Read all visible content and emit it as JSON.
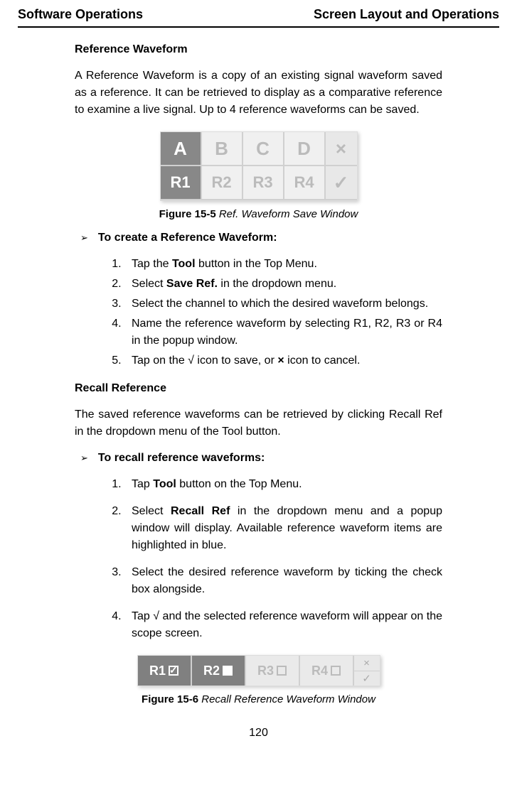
{
  "header": {
    "left": "Software Operations",
    "right": "Screen Layout and Operations"
  },
  "section1": {
    "title": "Reference Waveform",
    "para": "A Reference Waveform is a copy of an existing signal waveform saved as a reference. It can be retrieved to display as a comparative reference to examine a live signal. Up to 4 reference waveforms can be saved."
  },
  "fig5": {
    "row_top": [
      "A",
      "B",
      "C",
      "D",
      "×"
    ],
    "row_bot": [
      "R1",
      "R2",
      "R3",
      "R4",
      "✓"
    ],
    "caption_bold": "Figure 15-5",
    "caption_italic": " Ref. Waveform Save Window"
  },
  "proc1": {
    "title": "To create a Reference Waveform",
    "steps": {
      "s1a": "Tap the ",
      "s1b": "Tool",
      "s1c": " button in the Top Menu.",
      "s2a": "Select ",
      "s2b": "Save Ref.",
      "s2c": " in the dropdown menu.",
      "s3": "Select the channel to which the desired waveform belongs.",
      "s4": "Name the reference waveform by selecting R1, R2, R3 or R4 in the popup window.",
      "s5a": "Tap on the √ icon to save, or ",
      "s5b": "×",
      "s5c": " icon to cancel."
    }
  },
  "section2": {
    "title": "Recall Reference",
    "para": "The saved reference waveforms can be retrieved by clicking Recall Ref in the dropdown menu of the Tool button."
  },
  "proc2": {
    "title": "To recall reference waveforms:",
    "steps": {
      "s1a": "Tap ",
      "s1b": "Tool",
      "s1c": " button on the Top Menu.",
      "s2a": "Select ",
      "s2b": "Recall Ref",
      "s2c": " in the dropdown menu and a popup window will display. Available reference waveform items are highlighted in blue.",
      "s3": "Select the desired reference waveform by ticking the check box alongside.",
      "s4": "Tap √ and the selected reference waveform will appear on the scope screen."
    }
  },
  "fig6": {
    "cells": [
      "R1",
      "R2",
      "R3",
      "R4"
    ],
    "side": [
      "×",
      "✓"
    ],
    "caption_bold": "Figure 15-6",
    "caption_italic": " Recall Reference Waveform Window"
  },
  "page_number": "120"
}
